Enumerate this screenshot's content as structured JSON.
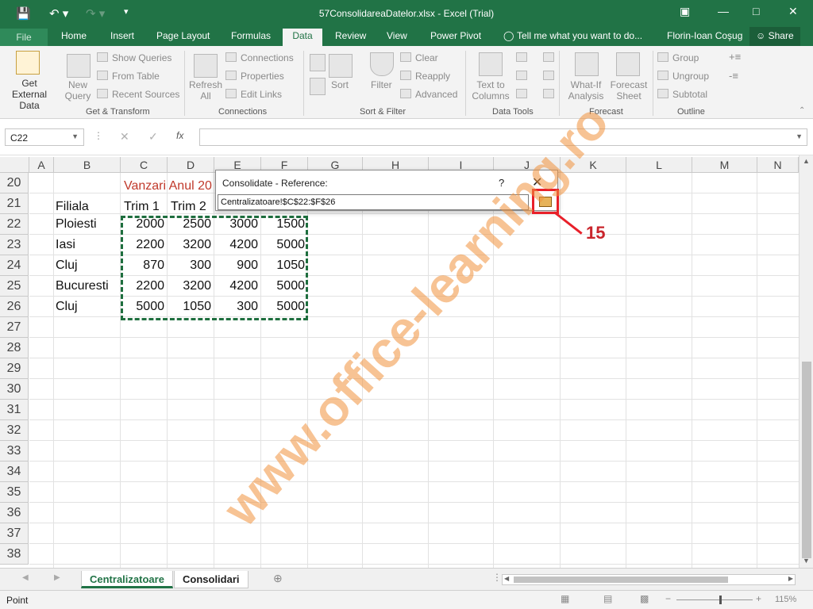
{
  "window": {
    "title": "57ConsolidareaDatelor.xlsx - Excel (Trial)",
    "user": "Florin-Ioan Coşug",
    "share_label": "Share",
    "tell_me": "Tell me what you want to do..."
  },
  "tabs": [
    "File",
    "Home",
    "Insert",
    "Page Layout",
    "Formulas",
    "Data",
    "Review",
    "View",
    "Power Pivot"
  ],
  "active_tab": "Data",
  "ribbon": {
    "get_external_data": "Get External Data",
    "new_query": "New Query",
    "show_queries": "Show Queries",
    "from_table": "From Table",
    "recent_sources": "Recent Sources",
    "group_get_transform": "Get & Transform",
    "refresh_all": "Refresh All",
    "connections": "Connections",
    "properties": "Properties",
    "edit_links": "Edit Links",
    "group_connections": "Connections",
    "sort": "Sort",
    "filter": "Filter",
    "clear": "Clear",
    "reapply": "Reapply",
    "advanced": "Advanced",
    "group_sort_filter": "Sort & Filter",
    "text_to_columns": "Text to Columns",
    "group_data_tools": "Data Tools",
    "what_if": "What-If Analysis",
    "forecast_sheet": "Forecast Sheet",
    "group_forecast": "Forecast",
    "group": "Group",
    "ungroup": "Ungroup",
    "subtotal": "Subtotal",
    "group_outline": "Outline"
  },
  "formula_bar": {
    "name_box": "C22",
    "fx": "fx",
    "value": ""
  },
  "columns": [
    "A",
    "B",
    "C",
    "D",
    "E",
    "F",
    "G",
    "H",
    "I",
    "J",
    "K",
    "L",
    "M",
    "N"
  ],
  "rows": [
    "20",
    "21",
    "22",
    "23",
    "24",
    "25",
    "26",
    "27",
    "28",
    "29",
    "30",
    "31",
    "32",
    "33",
    "34",
    "35",
    "36",
    "37",
    "38"
  ],
  "sheet": {
    "title_cell": "Vanzari Anul 20",
    "header_label": "Filiala",
    "quarters": [
      "Trim 1",
      "Trim 2"
    ],
    "data": [
      {
        "filiala": "Ploiesti",
        "values": [
          "2000",
          "2500",
          "3000",
          "1500"
        ]
      },
      {
        "filiala": "Iasi",
        "values": [
          "2200",
          "3200",
          "4200",
          "5000"
        ]
      },
      {
        "filiala": "Cluj",
        "values": [
          "870",
          "300",
          "900",
          "1050"
        ]
      },
      {
        "filiala": "Bucuresti",
        "values": [
          "2200",
          "3200",
          "4200",
          "5000"
        ]
      },
      {
        "filiala": "Cluj",
        "values": [
          "5000",
          "1050",
          "300",
          "5000"
        ]
      }
    ]
  },
  "dialog": {
    "title": "Consolidate - Reference:",
    "help": "?",
    "close": "X",
    "reference": "Centralizatoare!$C$22:$F$26"
  },
  "annotation": {
    "step_number": "15",
    "watermark": "www.office-learning.ro",
    "highlight_color": "#e8202a"
  },
  "sheet_tabs": [
    "Centralizatoare",
    "Consolidari"
  ],
  "active_sheet": "Centralizatoare",
  "status": {
    "mode": "Point",
    "zoom": "115%"
  },
  "colors": {
    "excel_green": "#217346",
    "title_red": "#c0392b"
  }
}
